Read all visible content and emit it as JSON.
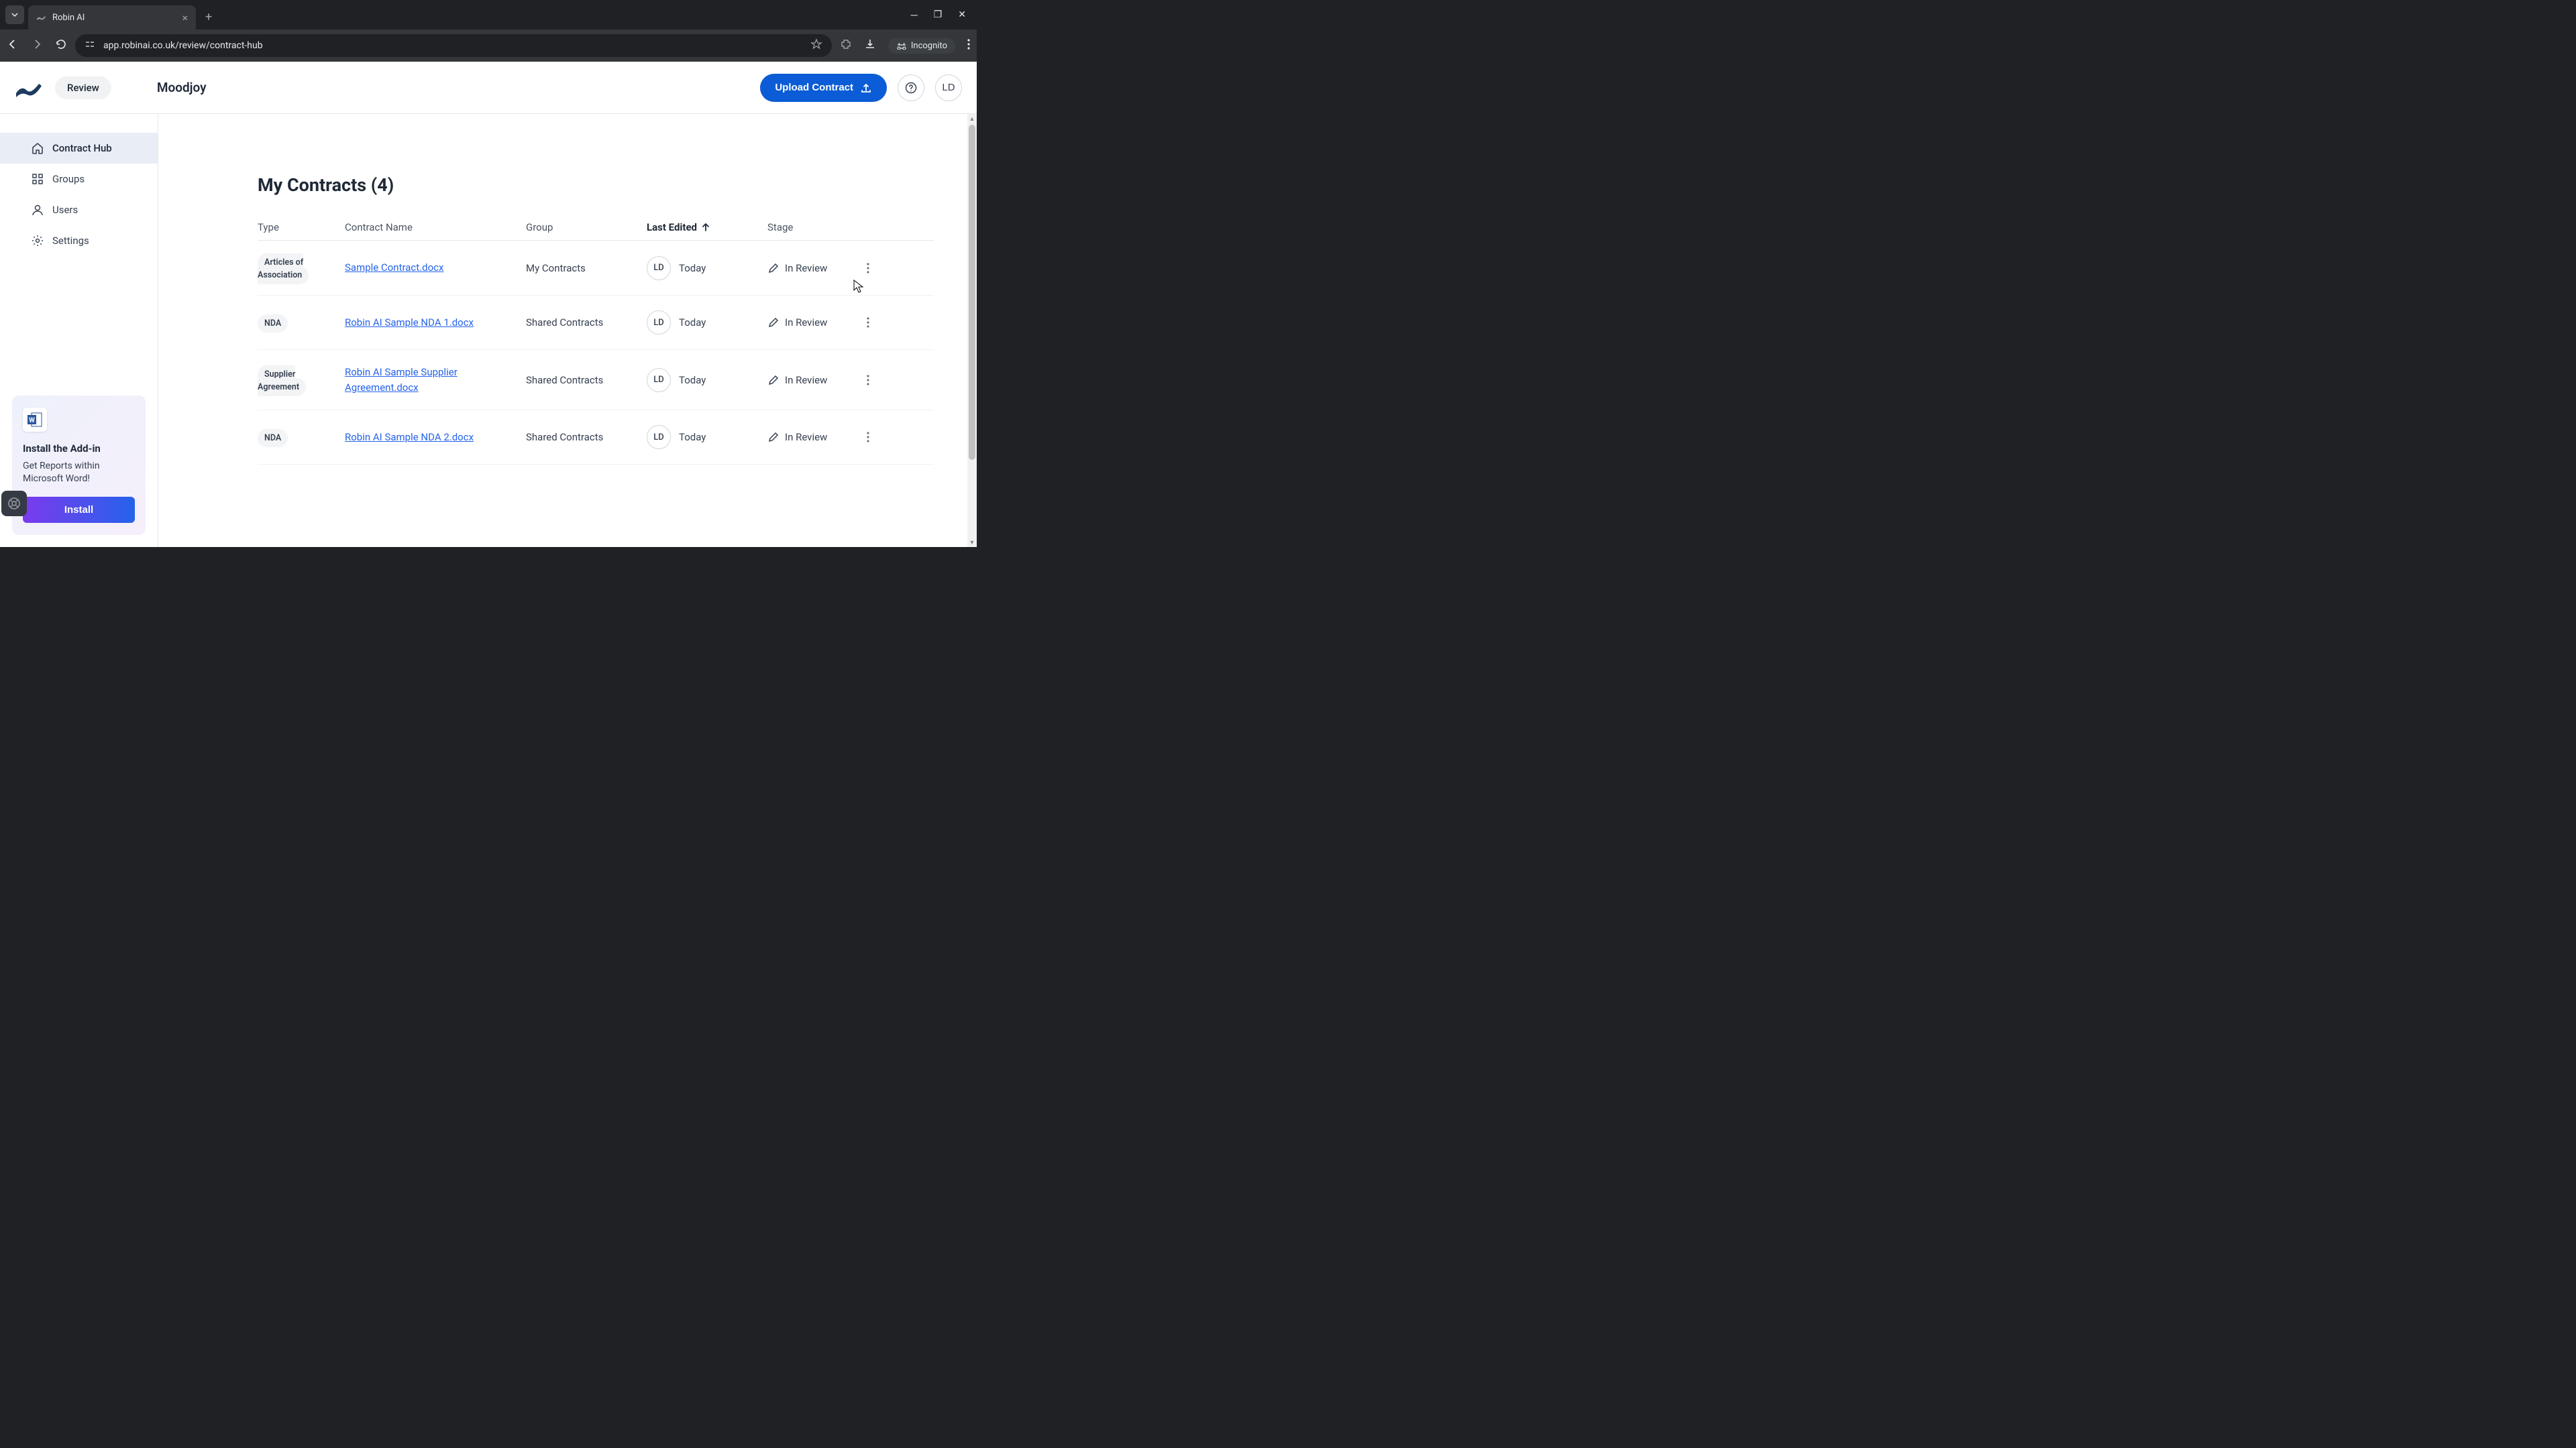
{
  "browser": {
    "tab_title": "Robin AI",
    "url": "app.robinai.co.uk/review/contract-hub",
    "incognito_label": "Incognito"
  },
  "header": {
    "review_label": "Review",
    "workspace": "Moodjoy",
    "upload_label": "Upload Contract",
    "avatar_initials": "LD"
  },
  "sidebar": {
    "items": [
      {
        "label": "Contract Hub",
        "active": true
      },
      {
        "label": "Groups",
        "active": false
      },
      {
        "label": "Users",
        "active": false
      },
      {
        "label": "Settings",
        "active": false
      }
    ],
    "addin": {
      "title": "Install the Add-in",
      "desc": "Get Reports within Microsoft Word!",
      "button": "Install"
    }
  },
  "main": {
    "title": "My Contracts (4)",
    "columns": {
      "type": "Type",
      "name": "Contract Name",
      "group": "Group",
      "edited": "Last Edited",
      "stage": "Stage"
    },
    "rows": [
      {
        "type": "Articles of Association",
        "name": "Sample Contract.docx",
        "group": "My Contracts",
        "editor": "LD",
        "edited": "Today",
        "stage": "In Review"
      },
      {
        "type": "NDA",
        "name": "Robin AI Sample NDA 1.docx",
        "group": "Shared Contracts",
        "editor": "LD",
        "edited": "Today",
        "stage": "In Review"
      },
      {
        "type": "Supplier Agreement",
        "name": "Robin AI Sample Supplier Agreement.docx",
        "group": "Shared Contracts",
        "editor": "LD",
        "edited": "Today",
        "stage": "In Review"
      },
      {
        "type": "NDA",
        "name": "Robin AI Sample NDA 2.docx",
        "group": "Shared Contracts",
        "editor": "LD",
        "edited": "Today",
        "stage": "In Review"
      }
    ]
  }
}
